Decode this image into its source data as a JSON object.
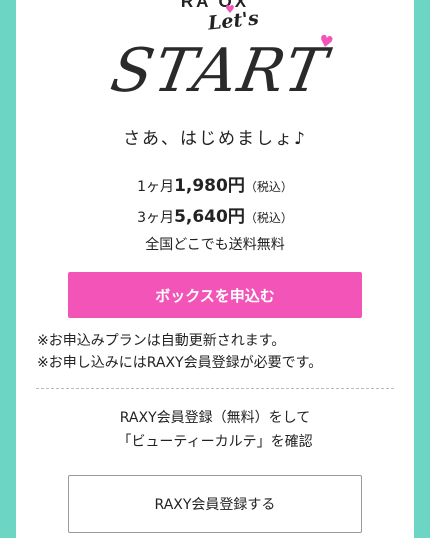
{
  "hero": {
    "arc_text": "RA                    OX",
    "lets": "Let's",
    "title": "START",
    "heart_icon": "♥",
    "tagline": "さあ、はじめましょ♪"
  },
  "pricing": {
    "monthly": {
      "period": "1ヶ月",
      "amount": "1,980円",
      "tax": "（税込）"
    },
    "quarterly": {
      "period": "3ヶ月",
      "amount": "5,640円",
      "tax": "（税込）"
    },
    "shipping": "全国どこでも送料無料"
  },
  "apply_button_label": "ボックスを申込む",
  "notes": [
    "※お申込みプランは自動更新されます。",
    "※お申し込みにはRAXY会員登録が必要です。"
  ],
  "register_info": {
    "line1": "RAXY会員登録（無料）をして",
    "line2": "「ビューティーカルテ」を確認"
  },
  "register_button_label": "RAXY会員登録する",
  "colors": {
    "accent_pink": "#f254b8",
    "border_teal": "#6dd5c4"
  }
}
